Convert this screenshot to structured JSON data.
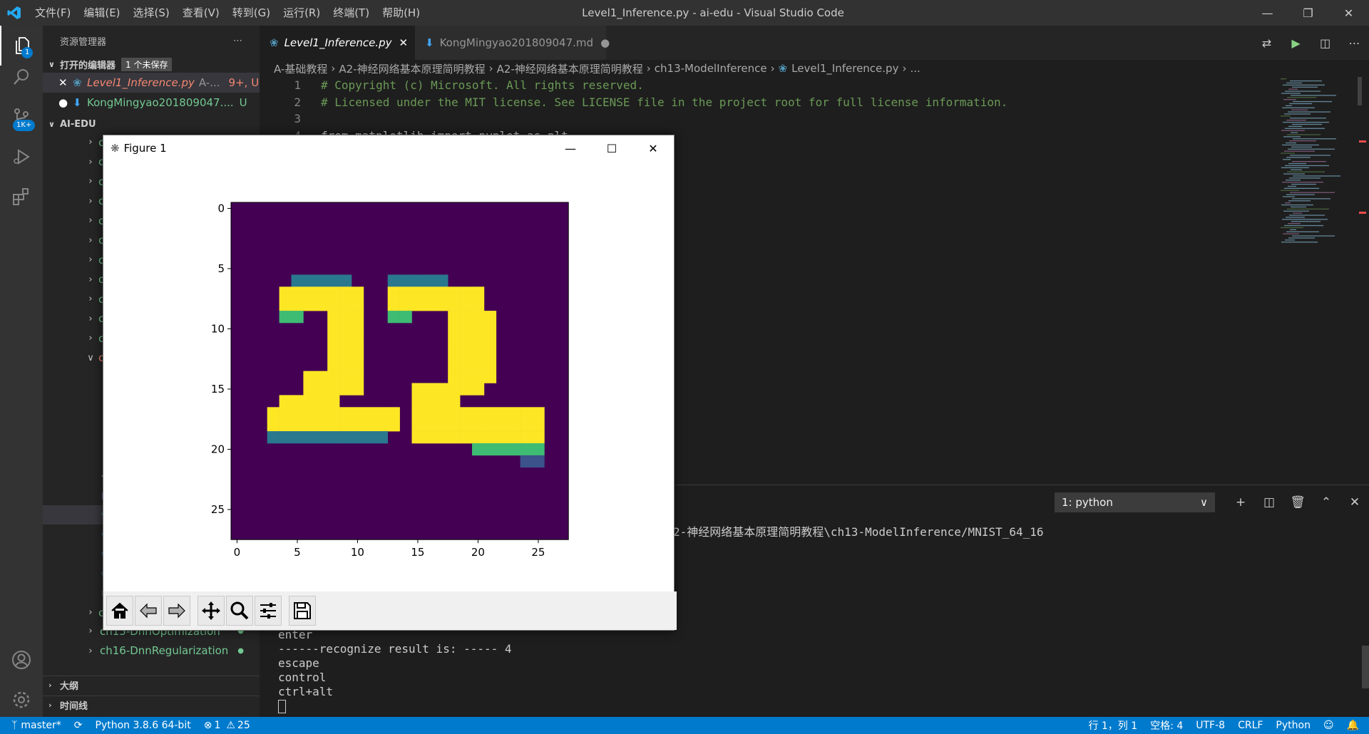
{
  "titlebar": {
    "menu": [
      "文件(F)",
      "编辑(E)",
      "选择(S)",
      "查看(V)",
      "转到(G)",
      "运行(R)",
      "终端(T)",
      "帮助(H)"
    ],
    "window_title": "Level1_Inference.py - ai-edu - Visual Studio Code"
  },
  "activity": {
    "explorer_badge": "1",
    "scm_badge": "1K+"
  },
  "sidebar": {
    "header": "资源管理器",
    "open_editors": {
      "title": "打开的编辑器",
      "unsaved": "1 个未保存"
    },
    "open_files": [
      {
        "name": "Level1_Inference.py",
        "desc": "A-...",
        "status": "9+, U"
      },
      {
        "name": "KongMingyao201809047....",
        "status": "U"
      }
    ],
    "workspace": "AI-EDU",
    "tree_prefix_top": "ch",
    "tree_prefix_open": "c",
    "tree_bottom": [
      {
        "name": "ch15-DnnOptimization"
      },
      {
        "name": "ch16-DnnRegularization"
      }
    ],
    "outline": "大纲",
    "timeline": "时间线"
  },
  "tabs": [
    {
      "label": "Level1_Inference.py",
      "active": true
    },
    {
      "label": "KongMingyao201809047.md",
      "active": false
    }
  ],
  "breadcrumb": [
    "A-基础教程",
    "A2-神经网络基本原理简明教程",
    "A2-神经网络基本原理简明教程",
    "ch13-ModelInference",
    "Level1_Inference.py",
    "..."
  ],
  "code": [
    {
      "n": "1",
      "text": "# Copyright (c) Microsoft. All rights reserved."
    },
    {
      "n": "2",
      "text": "# Licensed under the MIT license. See LICENSE file in the project root for full license information."
    },
    {
      "n": "3",
      "text": ""
    },
    {
      "n": "4",
      "text": "from matplotlib import pyplot as plt"
    }
  ],
  "terminal": {
    "selector": "1: python",
    "path_line": "2-神经网络基本原理简明教程\\ch13-ModelInference/MNIST_64_16",
    "lines": [
      "enter",
      "------recognize result is: ----- 4",
      "escape",
      "control",
      "ctrl+alt"
    ]
  },
  "figure": {
    "title": "Figure 1",
    "y_ticks": [
      "0",
      "5",
      "10",
      "15",
      "20",
      "25"
    ],
    "x_ticks": [
      "0",
      "5",
      "10",
      "15",
      "20",
      "25"
    ]
  },
  "status": {
    "branch": "master*",
    "python": "Python 3.8.6 64-bit",
    "errors": "1",
    "warnings": "25",
    "position": "行 1，列 1",
    "spaces": "空格: 4",
    "encoding": "UTF-8",
    "eol": "CRLF",
    "language": "Python"
  },
  "colors": {
    "accent": "#007acc",
    "viridis_low": "#440154",
    "viridis_high": "#fde725"
  }
}
